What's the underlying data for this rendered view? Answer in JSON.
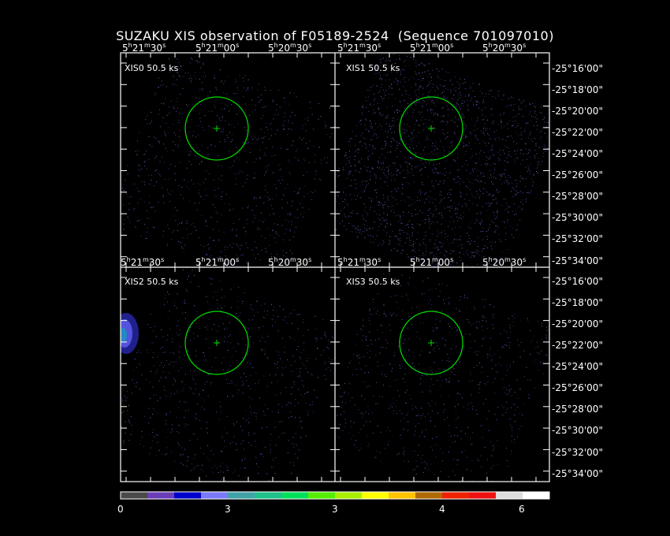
{
  "title": "SUZAKU XIS observation of F05189-2524  (Sequence 701097010)",
  "ra_top": [
    {
      "h": "5",
      "m": "21",
      "s": "30"
    },
    {
      "h": "5",
      "m": "21",
      "s": "00"
    },
    {
      "h": "5",
      "m": "20",
      "s": "30"
    }
  ],
  "ra_mid": [
    {
      "h": "5",
      "m": "21",
      "s": "30"
    },
    {
      "h": "5",
      "m": "21",
      "s": "00"
    },
    {
      "h": "5",
      "m": "20",
      "s": "30"
    }
  ],
  "dec_top": [
    "-25°16'00\"",
    "-25°18'00\"",
    "-25°20'00\"",
    "-25°22'00\"",
    "-25°24'00\"",
    "-25°26'00\"",
    "-25°28'00\"",
    "-25°30'00\"",
    "-25°32'00\"",
    "-25°34'00\""
  ],
  "dec_bottom": [
    "-25°16'00\"",
    "-25°18'00\"",
    "-25°20'00\"",
    "-25°22'00\"",
    "-25°24'00\"",
    "-25°26'00\"",
    "-25°28'00\"",
    "-25°30'00\"",
    "-25°32'00\"",
    "-25°34'00\""
  ],
  "panels": [
    {
      "label": "XIS0 50.5 ks",
      "density": 0.45
    },
    {
      "label": "XIS1 50.5 ks",
      "density": 1.0
    },
    {
      "label": "XIS2 50.5 ks",
      "density": 0.4
    },
    {
      "label": "XIS3 50.5 ks",
      "density": 0.4
    }
  ],
  "colorbar": {
    "colors": [
      "#4a4a4a",
      "#6a3db8",
      "#0000cc",
      "#7a7aff",
      "#3fa3a8",
      "#1fc08a",
      "#00e05a",
      "#55ee00",
      "#aaee00",
      "#ffff00",
      "#ffc400",
      "#b06a00",
      "#ee2200",
      "#ee1111",
      "#dddddd",
      "#ffffff"
    ],
    "ticks": [
      "0",
      "3",
      "3",
      "4",
      "6"
    ]
  },
  "colors": {
    "circle": "#00e000",
    "frame": "#ffffff",
    "events": "#7070e0"
  }
}
